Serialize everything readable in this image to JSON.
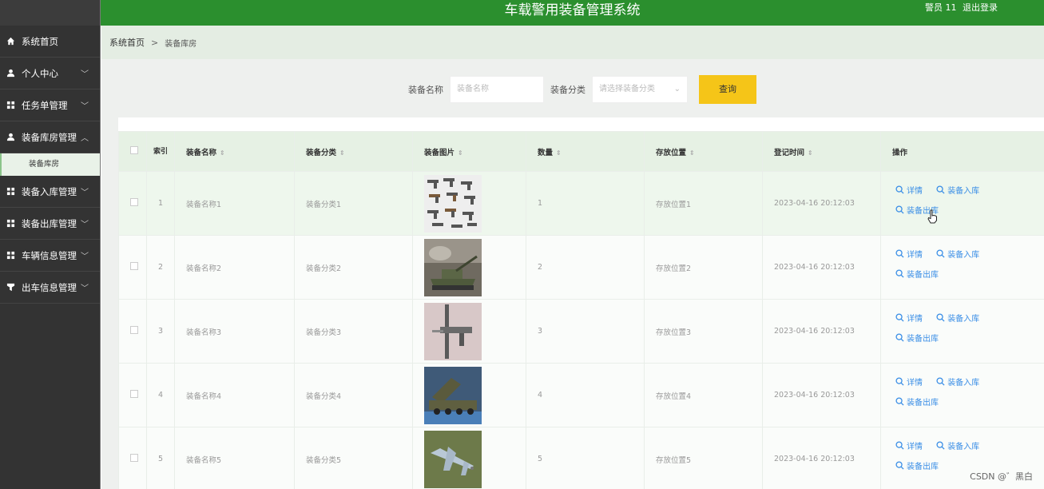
{
  "app": {
    "title": "车载警用装备管理系统",
    "user_label": "警员 11",
    "logout": "退出登录"
  },
  "sidebar": {
    "items": [
      {
        "label": "系统首页",
        "icon": "home-icon",
        "has_chevron": false
      },
      {
        "label": "个人中心",
        "icon": "user-icon",
        "has_chevron": true
      },
      {
        "label": "任务单管理",
        "icon": "grid-icon",
        "has_chevron": true
      },
      {
        "label": "装备库房管理",
        "icon": "user-icon",
        "has_chevron": true,
        "expanded": true
      },
      {
        "label": "装备入库管理",
        "icon": "grid-icon",
        "has_chevron": true
      },
      {
        "label": "装备出库管理",
        "icon": "grid-icon",
        "has_chevron": true
      },
      {
        "label": "车辆信息管理",
        "icon": "grid-icon",
        "has_chevron": true
      },
      {
        "label": "出车信息管理",
        "icon": "funnel-icon",
        "has_chevron": true
      }
    ],
    "submenu_active": "装备库房"
  },
  "breadcrumb": {
    "home": "系统首页",
    "sep": ">",
    "current": "装备库房"
  },
  "search": {
    "name_label": "装备名称",
    "name_placeholder": "装备名称",
    "category_label": "装备分类",
    "category_placeholder": "请选择装备分类",
    "query_button": "查询"
  },
  "table": {
    "headers": {
      "index": "索引",
      "name": "装备名称",
      "category": "装备分类",
      "image": "装备图片",
      "quantity": "数量",
      "location": "存放位置",
      "time": "登记时间",
      "ops": "操作"
    },
    "op_labels": {
      "detail": "详情",
      "stock_in": "装备入库",
      "stock_out": "装备出库"
    },
    "rows": [
      {
        "index": "1",
        "name": "装备名称1",
        "category": "装备分类1",
        "image": "pistols",
        "quantity": "1",
        "location": "存放位置1",
        "time": "2023-04-16 20:12:03"
      },
      {
        "index": "2",
        "name": "装备名称2",
        "category": "装备分类2",
        "image": "tank",
        "quantity": "2",
        "location": "存放位置2",
        "time": "2023-04-16 20:12:03"
      },
      {
        "index": "3",
        "name": "装备名称3",
        "category": "装备分类3",
        "image": "rifle",
        "quantity": "3",
        "location": "存放位置3",
        "time": "2023-04-16 20:12:03"
      },
      {
        "index": "4",
        "name": "装备名称4",
        "category": "装备分类4",
        "image": "rocket-launcher",
        "quantity": "4",
        "location": "存放位置4",
        "time": "2023-04-16 20:12:03"
      },
      {
        "index": "5",
        "name": "装备名称5",
        "category": "装备分类5",
        "image": "jet",
        "quantity": "5",
        "location": "存放位置5",
        "time": "2023-04-16 20:12:03"
      }
    ]
  },
  "watermark": "CSDN @゛黑白",
  "colors": {
    "topbar": "#2b8f2e",
    "sidebar": "#333333",
    "query_button": "#f5c518",
    "link": "#3a8ee6"
  }
}
